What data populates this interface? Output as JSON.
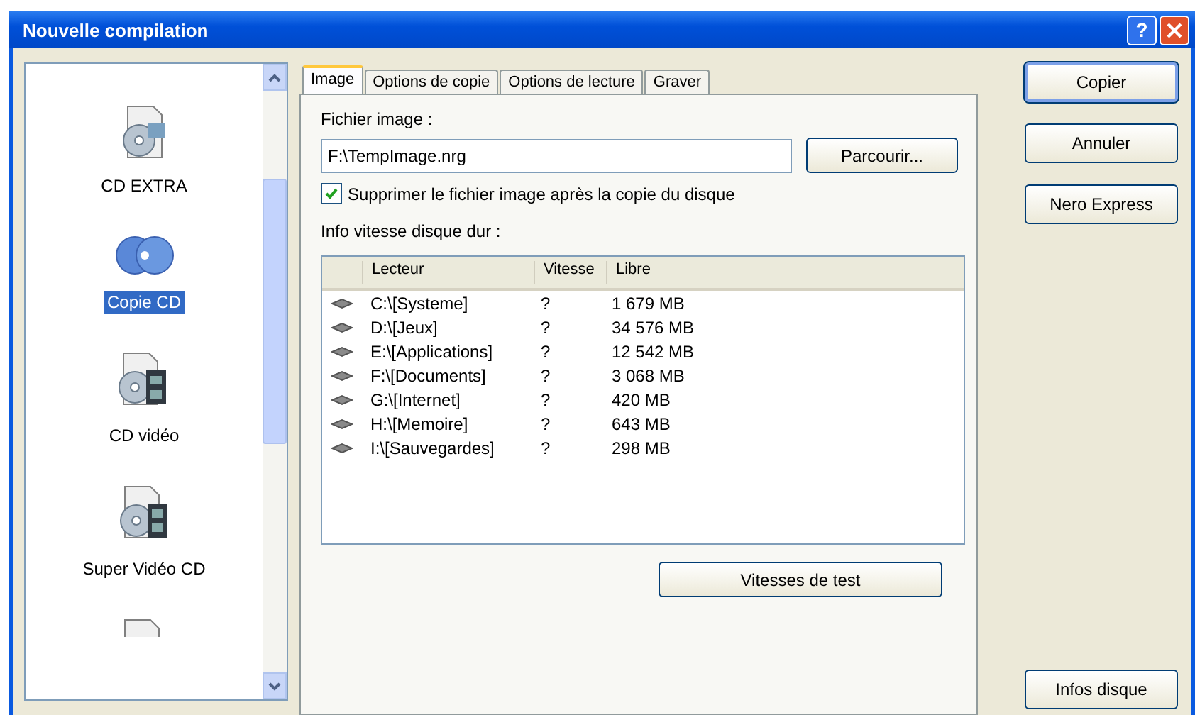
{
  "window": {
    "title": "Nouvelle compilation",
    "help": "?"
  },
  "sidebar": {
    "items": [
      {
        "label": "CD EXTRA",
        "kind": "extra",
        "selected": false
      },
      {
        "label": "Copie CD",
        "kind": "copy",
        "selected": true
      },
      {
        "label": "CD vidéo",
        "kind": "video",
        "selected": false
      },
      {
        "label": "Super Vidéo CD",
        "kind": "video",
        "selected": false
      }
    ]
  },
  "tabs": [
    {
      "label": "Image",
      "selected": true
    },
    {
      "label": "Options de copie",
      "selected": false
    },
    {
      "label": "Options de lecture",
      "selected": false
    },
    {
      "label": "Graver",
      "selected": false
    }
  ],
  "image_file": {
    "label": "Fichier image :",
    "value": "F:\\TempImage.nrg",
    "browse_button": "Parcourir..."
  },
  "delete_option": {
    "label": "Supprimer le fichier image après la copie du disque",
    "checked": true
  },
  "disk_info": {
    "label": "Info vitesse disque dur :",
    "columns": [
      "Lecteur",
      "Vitesse",
      "Libre"
    ],
    "rows": [
      {
        "drive": "C:\\[Systeme]",
        "speed": "?",
        "free": "1 679 MB"
      },
      {
        "drive": "D:\\[Jeux]",
        "speed": "?",
        "free": "34 576 MB"
      },
      {
        "drive": "E:\\[Applications]",
        "speed": "?",
        "free": "12 542 MB"
      },
      {
        "drive": "F:\\[Documents]",
        "speed": "?",
        "free": "3 068 MB"
      },
      {
        "drive": "G:\\[Internet]",
        "speed": "?",
        "free": "420 MB"
      },
      {
        "drive": "H:\\[Memoire]",
        "speed": "?",
        "free": "643 MB"
      },
      {
        "drive": "I:\\[Sauvegardes]",
        "speed": "?",
        "free": "298 MB"
      }
    ],
    "test_button": "Vitesses de test"
  },
  "buttons": [
    {
      "label": "Copier",
      "kind": "default"
    },
    {
      "label": "Annuler",
      "kind": "normal"
    },
    {
      "label": "Nero Express",
      "kind": "normal"
    },
    {
      "label": "Infos disque",
      "kind": "bottom"
    }
  ]
}
